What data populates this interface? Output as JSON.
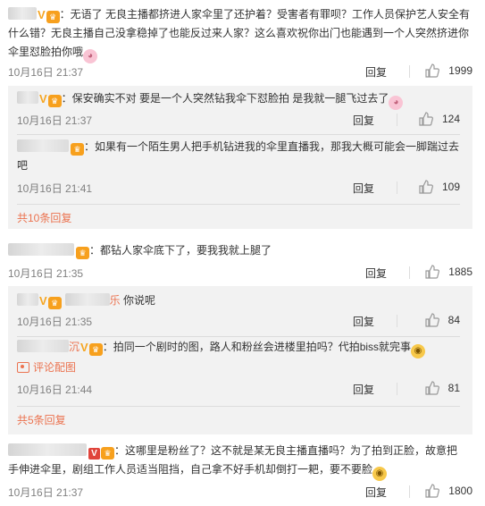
{
  "ui": {
    "reply_label": "回复"
  },
  "comments": [
    {
      "text_lines": [
        "：无语了 无良主播都挤进人家伞里了还护着？受害者有罪呗？工作人员保护艺人安全有",
        "什么错？无良主播自己没拿稳掉了也能反过来人家？这么喜欢祝你出门也能遇到一个人突然挤进你",
        "伞里怼脸拍你哦"
      ],
      "time": "10月16日 21:37",
      "likes": "1999"
    },
    {
      "text": "：都钻人家伞底下了，要我我就上腿了",
      "time": "10月16日 21:35",
      "likes": "1885"
    },
    {
      "text_lines": [
        "：这哪里是粉丝了？这不就是某无良主播直播吗？为了拍到正脸，故意把",
        "手伸进伞里，剧组工作人员适当阻挡，自己拿不好手机却倒打一耙，要不要脸"
      ],
      "time": "10月16日 21:37",
      "likes": "1800"
    }
  ],
  "replies_1": [
    {
      "text": "：保安确实不对 要是一个人突然钻我伞下怼脸拍 是我就一腿飞过去了",
      "time": "10月16日 21:37",
      "likes": "124"
    },
    {
      "text_lines": [
        "：如果有一个陌生男人把手机钻进我的伞里直播我，那我大概可能会一脚踹过去",
        "吧"
      ],
      "time": "10月16日 21:41",
      "likes": "109"
    }
  ],
  "more_1": "共10条回复",
  "replies_2": [
    {
      "name_tail": "乐",
      "text": " 你说呢",
      "time": "10月16日 21:35",
      "likes": "84"
    },
    {
      "name_tail": "沉",
      "text": "：拍同一个剧时的图，路人和粉丝会进楼里拍吗？代拍biss就完事",
      "image_link": "评论配图",
      "time": "10月16日 21:44",
      "likes": "81"
    }
  ],
  "more_2": "共5条回复",
  "icons": {
    "like": "thumbs-up-icon",
    "pig": "pig-emoji-icon",
    "smile": "smile-emoji-icon",
    "verified": "verified-v-icon",
    "vip": "vip-crown-icon",
    "image": "image-icon"
  },
  "colors": {
    "accent": "#eb7350",
    "sub_bg": "#f2f2f2",
    "text": "#333333",
    "meta": "#808080"
  }
}
